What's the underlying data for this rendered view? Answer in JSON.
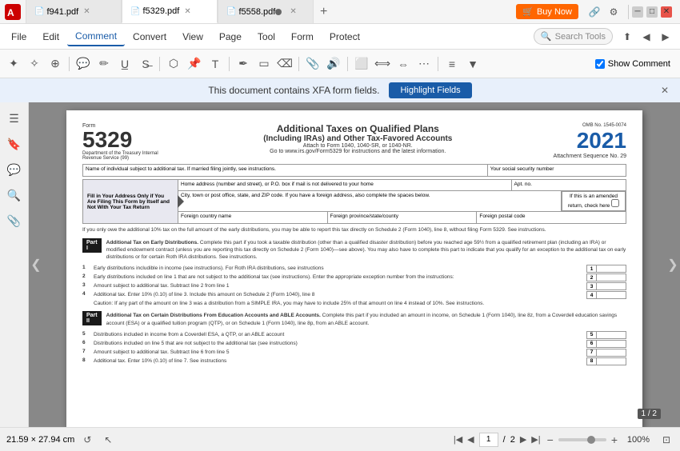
{
  "app": {
    "icon": "📄"
  },
  "tabs": [
    {
      "id": "f941",
      "label": "f941.pdf",
      "active": false,
      "modified": false
    },
    {
      "id": "f5329",
      "label": "f5329.pdf",
      "active": true,
      "modified": false
    },
    {
      "id": "f5558",
      "label": "f5558.pdf",
      "active": false,
      "modified": true
    }
  ],
  "window_controls": {
    "minimize": "─",
    "maximize": "□",
    "close": "✕"
  },
  "menu": {
    "items": [
      {
        "id": "file",
        "label": "File"
      },
      {
        "id": "edit",
        "label": "Edit"
      },
      {
        "id": "comment",
        "label": "Comment",
        "active": true
      },
      {
        "id": "convert",
        "label": "Convert"
      },
      {
        "id": "view",
        "label": "View"
      },
      {
        "id": "page",
        "label": "Page"
      },
      {
        "id": "tool",
        "label": "Tool"
      },
      {
        "id": "form",
        "label": "Form"
      },
      {
        "id": "protect",
        "label": "Protect"
      }
    ],
    "search_placeholder": "Search Tools",
    "buy_now": "Buy Now"
  },
  "xfa_banner": {
    "message": "This document contains XFA form fields.",
    "highlight_btn": "Highlight Fields",
    "close_icon": "✕"
  },
  "show_comment": {
    "label": "Show Comment",
    "checked": true
  },
  "document": {
    "form_label": "Form",
    "form_number": "5329",
    "dept_label": "Department of the Treasury  Internal Revenue Service (99)",
    "title_line1": "Additional Taxes on Qualified Plans",
    "title_line2": "(Including IRAs) and Other Tax-Favored Accounts",
    "attach_line": "Attach to Form 1040, 1040-SR, or 1040-NR.",
    "go_to_line": "Go to www.irs.gov/Form5329 for instructions and the latest information.",
    "omb_label": "OMB No. 1545-0074",
    "year": "2021",
    "seq_label": "Attachment Sequence No. 29",
    "ssn_label": "Your social security number",
    "name_label": "Name of individual subject to additional tax. If married filing jointly, see instructions.",
    "address_label": "Home address (number and street), or P.O. box if mail is not delivered to your home",
    "apt_label": "Apt. no.",
    "city_label": "City, town or post office, state, and ZIP code. If you have a foreign address, also complete the spaces below.",
    "country_label": "Foreign country name",
    "province_label": "Foreign province/state/county",
    "postal_label": "Foreign postal code",
    "amended_label": "If this is an amended return, check here",
    "fill_instruction": "Fill in Your Address Only if You Are Filing This Form by Itself and Not With Your Tax Return",
    "note_text": "If you only owe the additional 10% tax on the full amount of the early distributions, you may be able to report this tax directly on Schedule 2 (Form 1040), line 8, without filing Form 5329. See instructions.",
    "part1_label": "Part I",
    "part1_title": "Additional Tax on Early Distributions.",
    "part1_desc": "Complete this part if you took a taxable distribution (other than a qualified disaster distribution) before you reached age 59½ from a qualified retirement plan (including an IRA) or modified endowment contract (unless you are reporting this tax directly on Schedule 2 (Form 1040)—see above). You may also have to complete this part to indicate that you qualify for an exception to the additional tax on early distributions or for certain Roth IRA distributions. See instructions.",
    "lines": [
      {
        "num": "1",
        "text": "Early distributions includible in income (see instructions). For Roth IRA distributions, see instructions",
        "box_num": "1"
      },
      {
        "num": "2",
        "text": "Early distributions included on line 1 that are not subject to the additional tax (see instructions).\nEnter the appropriate exception number from the instructions:",
        "box_num": "2"
      },
      {
        "num": "3",
        "text": "Amount subject to additional tax. Subtract line 2 from line 1",
        "box_num": "3"
      },
      {
        "num": "4",
        "text": "Additional tax. Enter 10% (0.10) of line 3. Include this amount on Schedule 2 (Form 1040), line 8",
        "box_num": "4"
      }
    ],
    "caution_text": "Caution: If any part of the amount on line 3 was a distribution from a SIMPLE IRA, you may have  to include 25% of that amount on line 4 instead of 10%. See instructions.",
    "part2_label": "Part II",
    "part2_title": "Additional Tax on Certain Distributions From Education Accounts and ABLE Accounts.",
    "part2_desc": "Complete this part if you included an amount in income, on Schedule 1 (Form 1040), line 8z, from a Coverdell education savings account (ESA) or a qualified tuition program (QTP), or on Schedule 1 (Form 1040), line 8p, from an ABLE account.",
    "lines2": [
      {
        "num": "5",
        "text": "Distributions included in income from a Coverdell ESA, a QTP, or an ABLE account",
        "box_num": "5"
      },
      {
        "num": "6",
        "text": "Distributions included on line 5 that are not subject to the additional tax (see instructions)",
        "box_num": "6"
      },
      {
        "num": "7",
        "text": "Amount subject to additional tax. Subtract line 6 from line 5",
        "box_num": "7"
      },
      {
        "num": "8",
        "text": "Additional tax. Enter 10% (0.10) of line 7. See instructions",
        "box_num": "8"
      }
    ]
  },
  "status_bar": {
    "dimensions": "21.59 × 27.94 cm",
    "refresh_icon": "↺",
    "cursor_icon": "↖",
    "prev_page_icon": "◀",
    "first_page_icon": "◀◀",
    "next_page_icon": "▶",
    "last_page_icon": "▶▶",
    "current_page": "1",
    "total_pages": "1 / 2",
    "page_badge": "1 / 2",
    "zoom_minus": "−",
    "zoom_plus": "+",
    "zoom_level": "100%",
    "fit_icon": "⊡"
  },
  "sidebar_icons": [
    {
      "id": "nav",
      "icon": "☰",
      "label": "navigation-panel-icon"
    },
    {
      "id": "bookmark",
      "icon": "🔖",
      "label": "bookmark-icon"
    },
    {
      "id": "comment",
      "icon": "💬",
      "label": "comment-icon"
    },
    {
      "id": "search",
      "icon": "🔍",
      "label": "search-icon"
    },
    {
      "id": "attachment",
      "icon": "📎",
      "label": "attachment-icon"
    }
  ],
  "nav_arrows": {
    "left": "❮",
    "right": "❯"
  }
}
